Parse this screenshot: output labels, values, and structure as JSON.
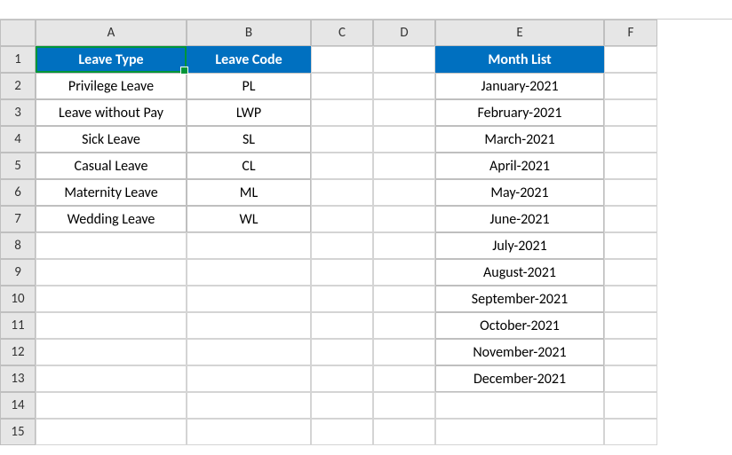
{
  "columns": [
    "A",
    "B",
    "C",
    "D",
    "E",
    "F"
  ],
  "rows": [
    "1",
    "2",
    "3",
    "4",
    "5",
    "6",
    "7",
    "8",
    "9",
    "10",
    "11",
    "12",
    "13",
    "14",
    "15"
  ],
  "headers": {
    "leave_type": "Leave Type",
    "leave_code": "Leave Code",
    "month_list": "Month List"
  },
  "leave_entries": [
    {
      "type": "Privilege Leave",
      "code": "PL"
    },
    {
      "type": "Leave without Pay",
      "code": "LWP"
    },
    {
      "type": "Sick Leave",
      "code": "SL"
    },
    {
      "type": "Casual Leave",
      "code": "CL"
    },
    {
      "type": "Maternity Leave",
      "code": "ML"
    },
    {
      "type": "Wedding Leave",
      "code": "WL"
    }
  ],
  "months": [
    "January-2021",
    "February-2021",
    "March-2021",
    "April-2021",
    "May-2021",
    "June-2021",
    "July-2021",
    "August-2021",
    "September-2021",
    "October-2021",
    "November-2021",
    "December-2021"
  ],
  "selected_cell": "A1"
}
